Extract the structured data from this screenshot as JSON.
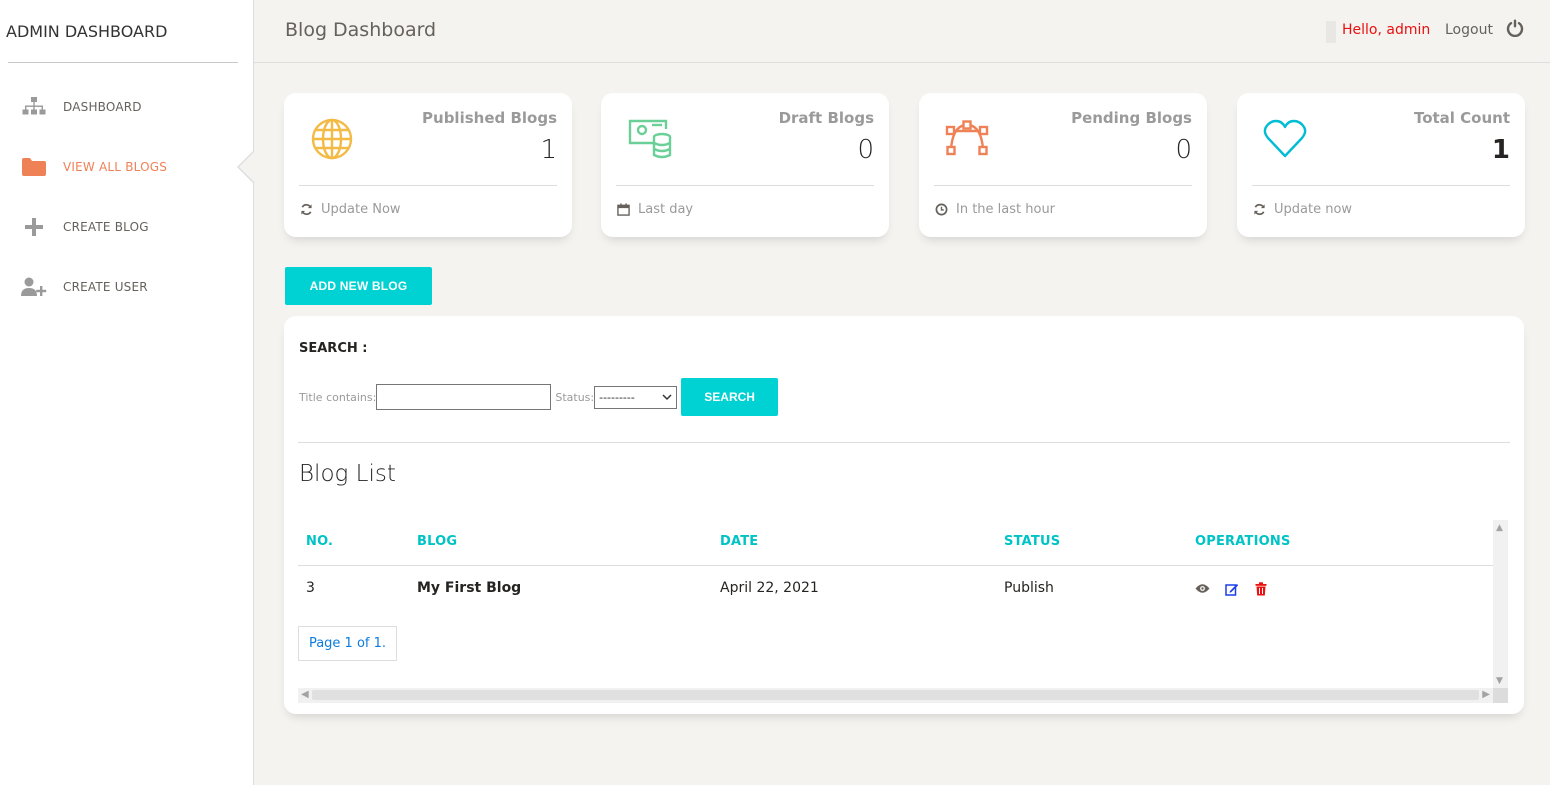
{
  "sidebar": {
    "brand": "ADMIN DASHBOARD",
    "items": [
      {
        "label": "DASHBOARD",
        "icon": "sitemap-icon"
      },
      {
        "label": "VIEW ALL BLOGS",
        "icon": "folder-icon",
        "active": true
      },
      {
        "label": "CREATE BLOG",
        "icon": "plus-icon"
      },
      {
        "label": "CREATE USER",
        "icon": "user-plus-icon"
      }
    ]
  },
  "topbar": {
    "title": "Blog Dashboard",
    "greeting": "Hello, admin",
    "logout": "Logout"
  },
  "stats": [
    {
      "label": "Published Blogs",
      "value": "1",
      "footer": "Update Now",
      "icon": "globe-icon",
      "footer_icon": "refresh-icon"
    },
    {
      "label": "Draft Blogs",
      "value": "0",
      "footer": "Last day",
      "icon": "money-database-icon",
      "footer_icon": "calendar-icon"
    },
    {
      "label": "Pending Blogs",
      "value": "0",
      "footer": "In the last hour",
      "icon": "vector-path-icon",
      "footer_icon": "clock-icon"
    },
    {
      "label": "Total Count",
      "value": "1",
      "footer": "Update now",
      "icon": "heart-icon",
      "footer_icon": "refresh-icon"
    }
  ],
  "actions": {
    "add_new": "ADD NEW BLOG"
  },
  "search": {
    "title": "SEARCH :",
    "title_label": "Title contains:",
    "title_value": "",
    "status_label": "Status:",
    "status_selected": "---------",
    "button": "SEARCH"
  },
  "blog_list": {
    "title": "Blog List",
    "columns": [
      "NO.",
      "BLOG",
      "DATE",
      "STATUS",
      "OPERATIONS"
    ],
    "rows": [
      {
        "no": "3",
        "blog": "My First Blog",
        "date": "April 22, 2021",
        "status": "Publish"
      }
    ],
    "pagination": "Page 1 of 1."
  },
  "colors": {
    "accent": "#00d1d3",
    "active_nav": "#ef8157",
    "greeting": "#e8110f",
    "published_icon": "#f3bb45",
    "draft_icon": "#6bd098",
    "pending_icon": "#ef8157",
    "total_icon": "#00bcd4"
  }
}
